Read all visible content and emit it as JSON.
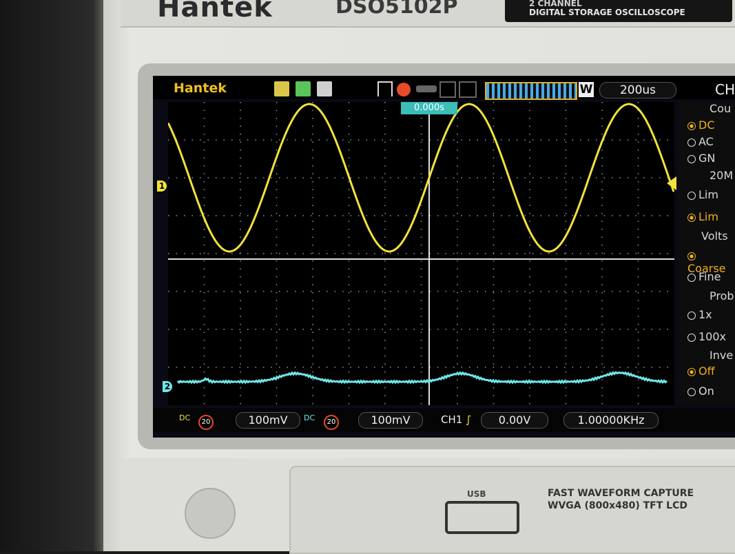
{
  "device": {
    "brand": "Hantek",
    "model": "DSO5102P",
    "subtitle_line1": "2 CHANNEL",
    "subtitle_line2": "DIGITAL STORAGE OSCILLOSCOPE"
  },
  "screen_header": {
    "brand": "Hantek",
    "timebase": "200us",
    "trigger_offset": "0.000s",
    "panel_title": "CH"
  },
  "right_panel": {
    "coupling_title": "Cou",
    "coupling_opts": [
      "DC",
      "AC",
      "GN"
    ],
    "bw_title": "20M",
    "bw_opts": [
      "Lim",
      "Lim"
    ],
    "volts_title": "Volts",
    "volts_opts": [
      "Coarse",
      "Fine"
    ],
    "probe_title": "Prob",
    "probe_opts": [
      "1x",
      "100x"
    ],
    "invert_title": "Inve",
    "invert_opts": [
      "Off",
      "On"
    ]
  },
  "channels": [
    {
      "label": "1",
      "color": "#f2e33a"
    },
    {
      "label": "2",
      "color": "#6fe6e8"
    }
  ],
  "bottom_bar": {
    "ch1_volts": "100mV",
    "ch2_volts": "100mV",
    "trigger_source": "CH1",
    "trigger_level": "0.00V",
    "frequency": "1.00000KHz"
  },
  "lower_bezel": {
    "usb": "USB",
    "feature1": "FAST WAVEFORM CAPTURE",
    "feature2": "WVGA (800x480) TFT LCD"
  }
}
